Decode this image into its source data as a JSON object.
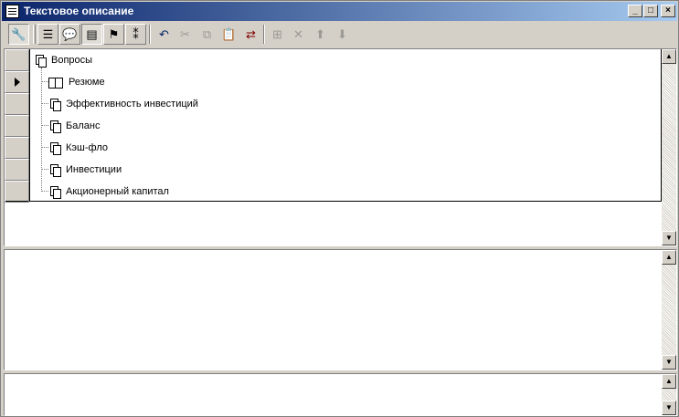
{
  "window": {
    "title": "Текстовое описание",
    "minimize_label": "_",
    "maximize_label": "□",
    "close_label": "×"
  },
  "toolbar": {
    "items": [
      {
        "id": "wrench",
        "glyph": "🔧",
        "state": "pressed"
      },
      {
        "id": "outline",
        "glyph": "☰",
        "state": "raised"
      },
      {
        "id": "comment",
        "glyph": "💬",
        "state": "raised"
      },
      {
        "id": "text-block",
        "glyph": "▤",
        "state": "pressed"
      },
      {
        "id": "bookmark",
        "glyph": "⚑",
        "state": "raised"
      },
      {
        "id": "numbering",
        "glyph": "⁑",
        "state": "raised"
      },
      {
        "id": "undo",
        "glyph": "↶",
        "state": "normal"
      },
      {
        "id": "cut",
        "glyph": "✂",
        "state": "disabled"
      },
      {
        "id": "copy",
        "glyph": "⧉",
        "state": "disabled"
      },
      {
        "id": "paste",
        "glyph": "📋",
        "state": "normal"
      },
      {
        "id": "replace",
        "glyph": "⇄",
        "state": "normal"
      },
      {
        "id": "insert",
        "glyph": "⊞",
        "state": "disabled"
      },
      {
        "id": "delete",
        "glyph": "✕",
        "state": "disabled"
      },
      {
        "id": "move-up",
        "glyph": "⬆",
        "state": "disabled"
      },
      {
        "id": "move-down",
        "glyph": "⬇",
        "state": "disabled"
      }
    ]
  },
  "tree": {
    "root": {
      "label": "Вопросы",
      "icon": "doc-icon"
    },
    "children": [
      {
        "label": "Резюме",
        "icon": "book-icon",
        "current": true
      },
      {
        "label": "Эффективность инвестиций",
        "icon": "doc-icon"
      },
      {
        "label": "Баланс",
        "icon": "doc-icon"
      },
      {
        "label": "Кэш-фло",
        "icon": "doc-icon"
      },
      {
        "label": "Инвестиции",
        "icon": "doc-icon"
      },
      {
        "label": "Акционерный капитал",
        "icon": "doc-icon"
      }
    ]
  },
  "scroll": {
    "up_arrow": "▲",
    "down_arrow": "▼"
  }
}
